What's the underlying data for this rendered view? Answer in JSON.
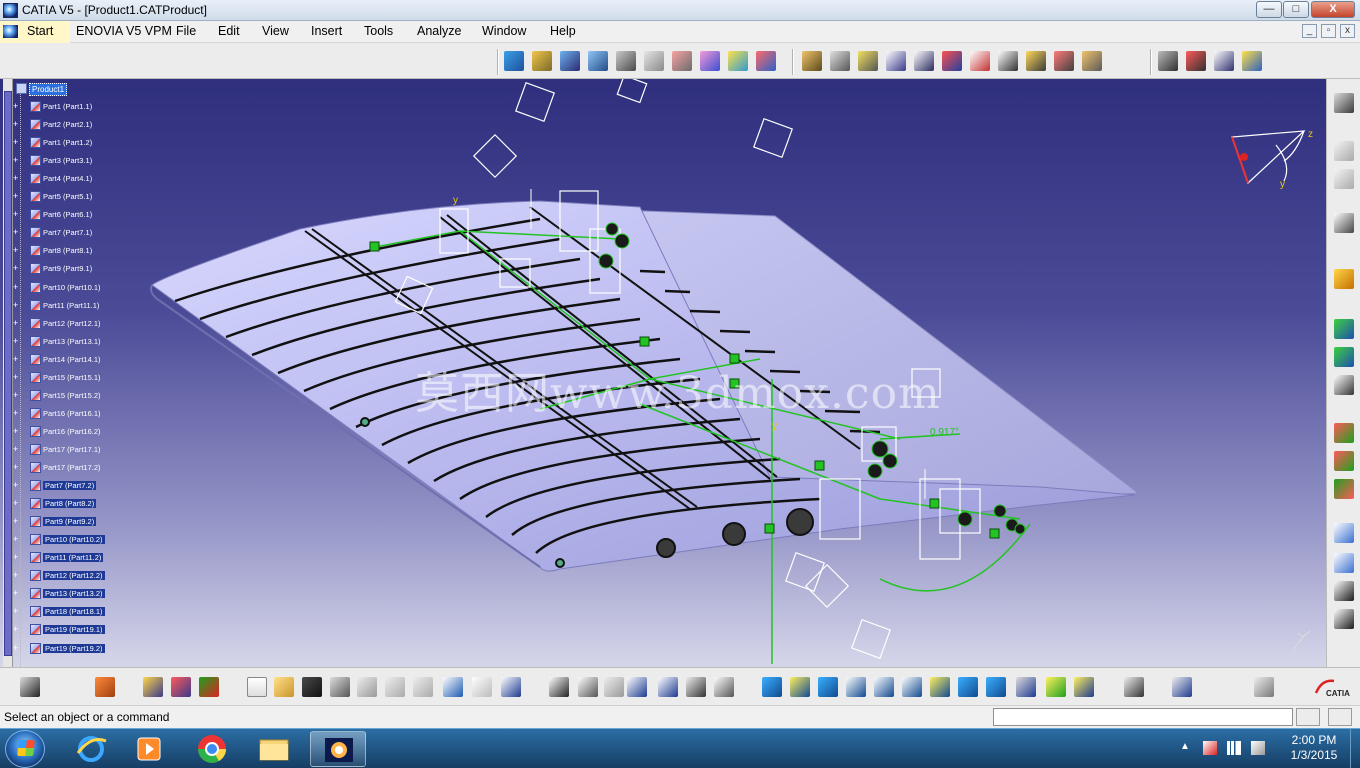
{
  "window": {
    "title": "CATIA V5 - [Product1.CATProduct]",
    "minimize": "—",
    "maximize": "□",
    "close": "X"
  },
  "menu": {
    "start": "Start",
    "items": [
      "ENOVIA V5 VPM",
      "File",
      "Edit",
      "View",
      "Insert",
      "Tools",
      "Analyze",
      "Window",
      "Help"
    ]
  },
  "mdi": {
    "minimize": "_",
    "restore": "▫",
    "close": "x"
  },
  "tree": {
    "root": "Product1",
    "items": [
      "Part1 (Part1.1)",
      "Part2 (Part2.1)",
      "Part1 (Part1.2)",
      "Part3 (Part3.1)",
      "Part4 (Part4.1)",
      "Part5 (Part5.1)",
      "Part6 (Part6.1)",
      "Part7 (Part7.1)",
      "Part8 (Part8.1)",
      "Part9 (Part9.1)",
      "Part10 (Part10.1)",
      "Part11 (Part11.1)",
      "Part12 (Part12.1)",
      "Part13 (Part13.1)",
      "Part14 (Part14.1)",
      "Part15 (Part15.1)",
      "Part15 (Part15.2)",
      "Part16 (Part16.1)",
      "Part16 (Part16.2)",
      "Part17 (Part17.1)",
      "Part17 (Part17.2)",
      "Part7 (Part7.2)",
      "Part8 (Part8.2)",
      "Part9 (Part9.2)",
      "Part10 (Part10.2)",
      "Part11 (Part11.2)",
      "Part12 (Part12.2)",
      "Part13 (Part13.2)",
      "Part18 (Part18.1)",
      "Part19 (Part19.1)",
      "Part19 (Part19.2)"
    ],
    "selected_from_index": 21
  },
  "viewport": {
    "watermark": "莫西网www.3dmox.com",
    "angle_annotation": "0.917°",
    "compass": {
      "z": "z",
      "y": "y"
    }
  },
  "statusbar": {
    "message": "Select an object or a command",
    "command_input": ""
  },
  "taskbar": {
    "time": "2:00 PM",
    "date": "1/3/2015"
  },
  "colors": {
    "viewport_top": "#2f2f7e",
    "viewport_bottom": "#d6d6ea",
    "wing": "#b8b8ee",
    "constraint": "#22c322",
    "tree_selection": "#1f3a96"
  }
}
